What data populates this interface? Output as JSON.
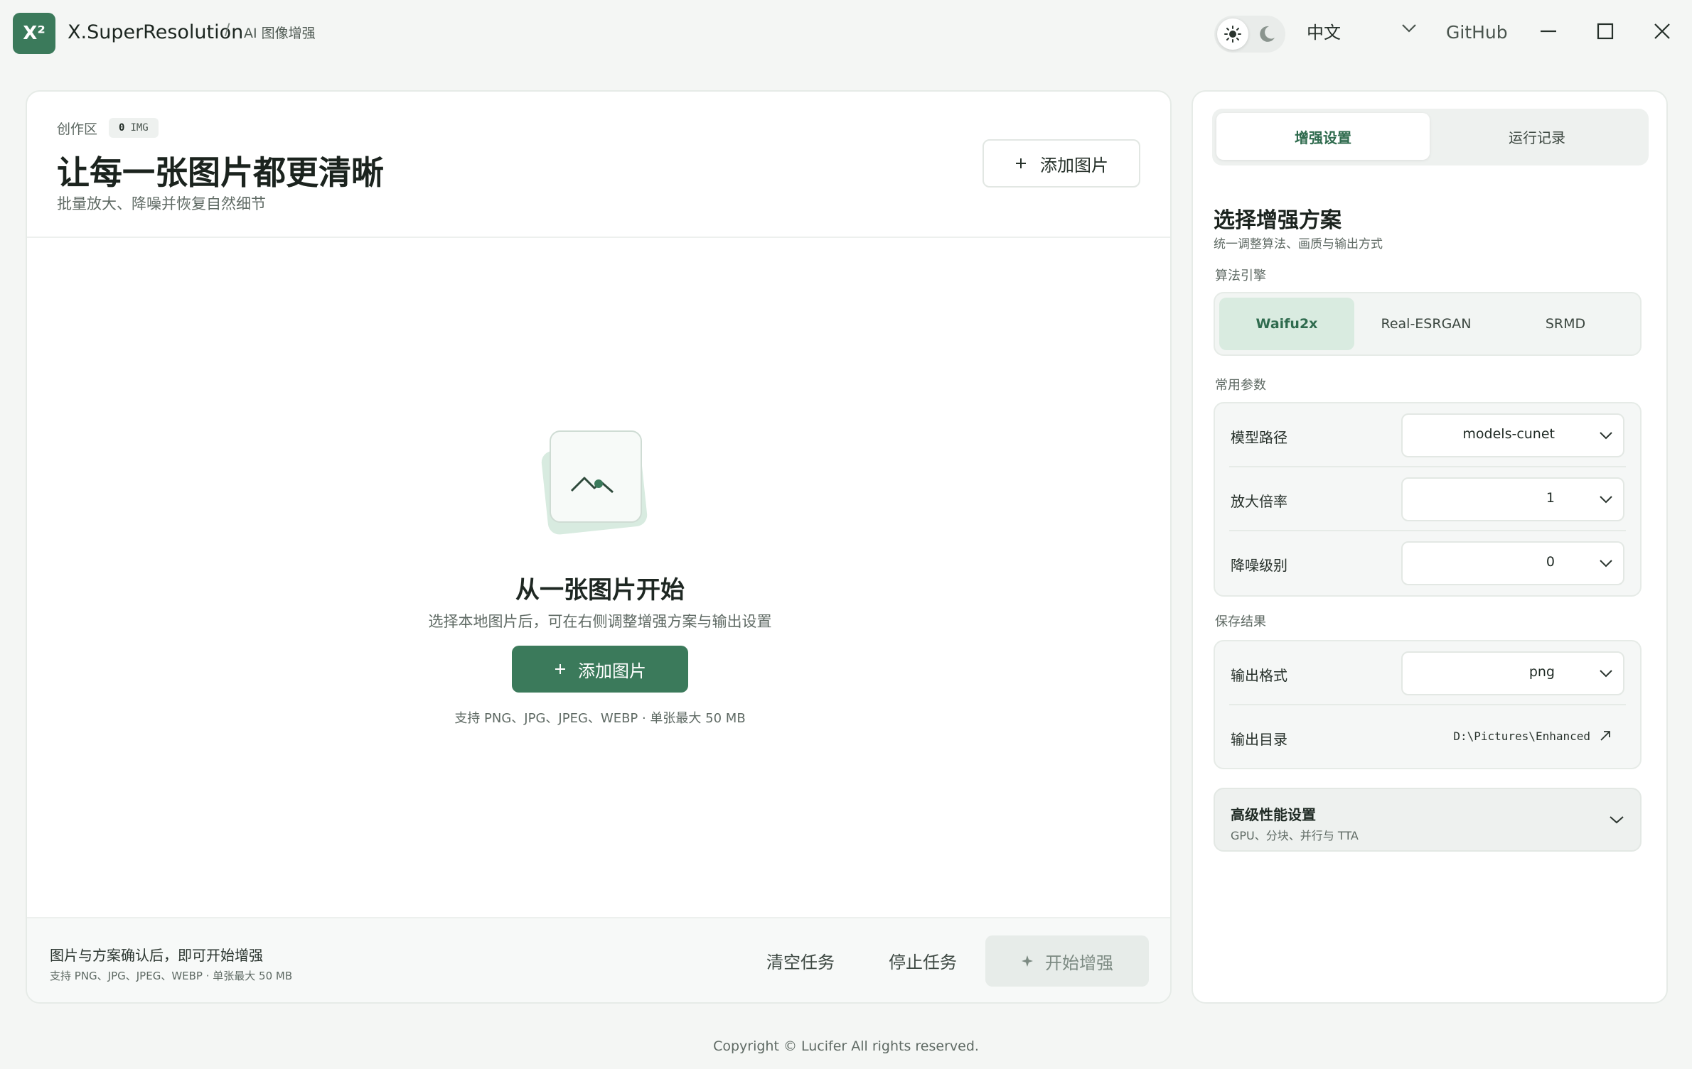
{
  "app": {
    "logo_text": "X²",
    "name": "X.SuperResolution",
    "breadcrumb_sep": "/",
    "breadcrumb": "AI 图像增强",
    "language": "中文",
    "github": "GitHub"
  },
  "workspace": {
    "label": "创作区",
    "img_count": "0",
    "img_unit": "IMG",
    "title": "让每一张图片都更清晰",
    "subtitle": "批量放大、降噪并恢复自然细节",
    "add_button": "添加图片"
  },
  "empty_state": {
    "title": "从一张图片开始",
    "subtitle": "选择本地图片后，可在右侧调整增强方案与输出设置",
    "add_button": "添加图片",
    "support": "支持 PNG、JPG、JPEG、WEBP · 单张最大 50 MB"
  },
  "footer": {
    "hint": "图片与方案确认后，即可开始增强",
    "support": "支持 PNG、JPG、JPEG、WEBP · 单张最大 50 MB",
    "clear": "清空任务",
    "stop": "停止任务",
    "start": "开始增强"
  },
  "side": {
    "tabs": [
      "增强设置",
      "运行记录"
    ],
    "title": "选择增强方案",
    "subtitle": "统一调整算法、画质与输出方式",
    "engine_label": "算法引擎",
    "engines": [
      "Waifu2x",
      "Real-ESRGAN",
      "SRMD"
    ],
    "selected_engine": "Waifu2x",
    "params_label": "常用参数",
    "params": [
      {
        "label": "模型路径",
        "value": "models-cunet"
      },
      {
        "label": "放大倍率",
        "value": "1"
      },
      {
        "label": "降噪级别",
        "value": "0"
      }
    ],
    "save_label": "保存结果",
    "output_format_label": "输出格式",
    "output_format": "png",
    "output_dir_label": "输出目录",
    "output_dir": "D:\\Pictures\\Enhanced",
    "advanced_title": "高级性能设置",
    "advanced_sub": "GPU、分块、并行与 TTA"
  },
  "copyright": "Copyright © Lucifer All rights reserved.",
  "colors": {
    "accent": "#3b7a5b",
    "accent_soft": "#d9ebe0",
    "background": "#f4f6f4"
  }
}
